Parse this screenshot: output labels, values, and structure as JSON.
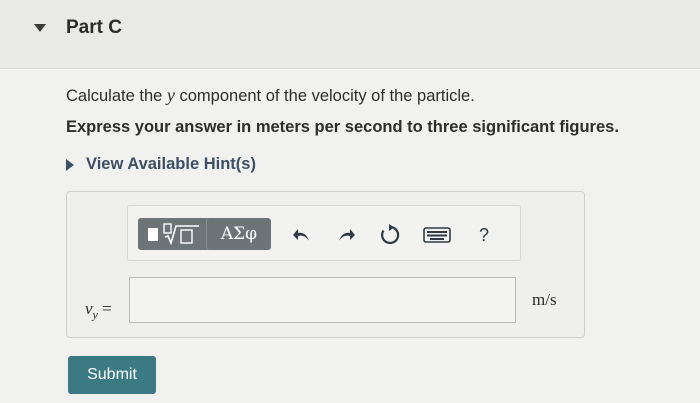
{
  "part": {
    "title": "Part C"
  },
  "question": {
    "prefix": "Calculate the ",
    "variable": "y",
    "suffix": " component of the velocity of the particle.",
    "instruction": "Express your answer in meters per second to three significant figures."
  },
  "hint": {
    "label": "View Available Hint(s)"
  },
  "toolbar": {
    "greek_label": "ΑΣφ",
    "math_template_icon": "square-root-template-icon",
    "help_label": "?"
  },
  "answer": {
    "variable": "v",
    "subscript": "y",
    "equals": "=",
    "value": "",
    "unit": "m/s"
  },
  "submit": {
    "label": "Submit"
  },
  "colors": {
    "submit_bg": "#3c7a83",
    "toolbar_button_bg": "#6d7478",
    "hint_text": "#3d4f63"
  }
}
